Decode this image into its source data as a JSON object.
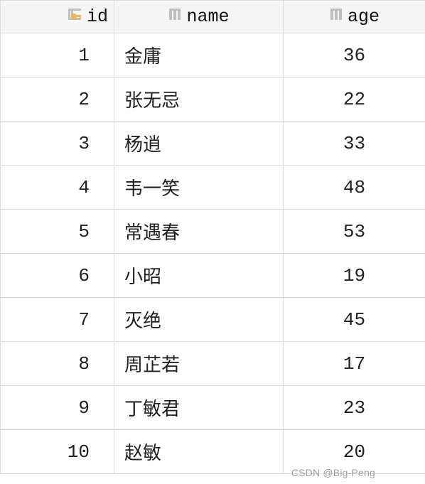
{
  "columns": {
    "id": {
      "label": "id"
    },
    "name": {
      "label": "name"
    },
    "age": {
      "label": "age"
    }
  },
  "rows": [
    {
      "id": "1",
      "name": "金庸",
      "age": "36"
    },
    {
      "id": "2",
      "name": "张无忌",
      "age": "22"
    },
    {
      "id": "3",
      "name": "杨逍",
      "age": "33"
    },
    {
      "id": "4",
      "name": "韦一笑",
      "age": "48"
    },
    {
      "id": "5",
      "name": "常遇春",
      "age": "53"
    },
    {
      "id": "6",
      "name": "小昭",
      "age": "19"
    },
    {
      "id": "7",
      "name": "灭绝",
      "age": "45"
    },
    {
      "id": "8",
      "name": "周芷若",
      "age": "17"
    },
    {
      "id": "9",
      "name": "丁敏君",
      "age": "23"
    },
    {
      "id": "10",
      "name": "赵敏",
      "age": "20"
    }
  ],
  "watermark": "CSDN @Big-Peng"
}
